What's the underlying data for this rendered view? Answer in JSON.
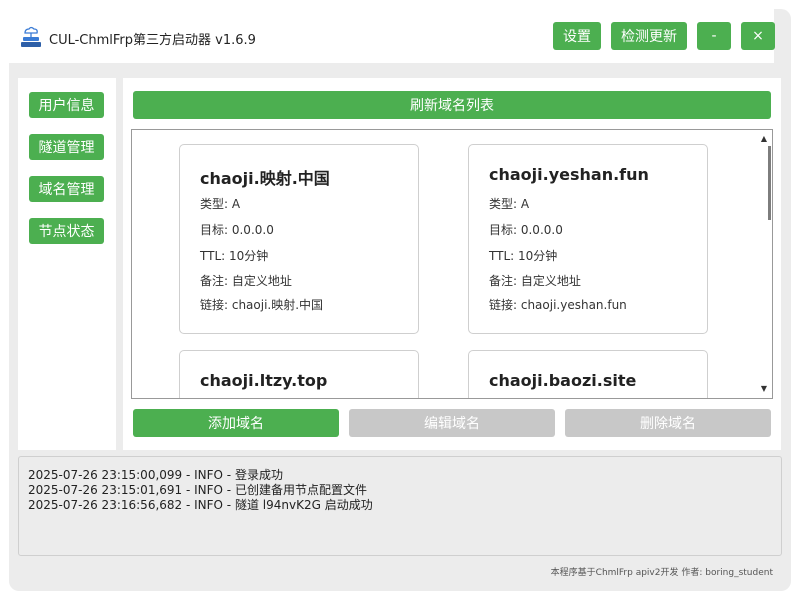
{
  "app": {
    "title": "CUL-ChmlFrp第三方启动器 v1.6.9",
    "icon": "cloud-server-icon"
  },
  "header": {
    "settings_label": "设置",
    "update_label": "检测更新",
    "minimize_label": "-",
    "close_label": "×"
  },
  "sidebar": {
    "items": [
      {
        "label": "用户信息"
      },
      {
        "label": "隧道管理"
      },
      {
        "label": "域名管理"
      },
      {
        "label": "节点状态"
      }
    ]
  },
  "main": {
    "refresh_label": "刷新域名列表",
    "domains": [
      {
        "name": "chaoji.映射.中国",
        "type": "类型: A",
        "target": "目标: 0.0.0.0",
        "ttl": "TTL: 10分钟",
        "remark": "备注: 自定义地址",
        "link": "链接: chaoji.映射.中国"
      },
      {
        "name": "chaoji.yeshan.fun",
        "type": "类型: A",
        "target": "目标: 0.0.0.0",
        "ttl": "TTL: 10分钟",
        "remark": "备注: 自定义地址",
        "link": "链接: chaoji.yeshan.fun"
      },
      {
        "name": "chaoji.ltzy.top"
      },
      {
        "name": "chaoji.baozi.site"
      }
    ],
    "add_label": "添加域名",
    "edit_label": "编辑域名",
    "delete_label": "删除域名"
  },
  "log": {
    "lines": [
      "2025-07-26 23:15:00,099 - INFO - 登录成功",
      "2025-07-26 23:15:01,691 - INFO - 已创建备用节点配置文件",
      "2025-07-26 23:16:56,682 - INFO - 隧道 l94nvK2G 启动成功"
    ]
  },
  "footer": {
    "text": "本程序基于ChmlFrp apiv2开发 作者: boring_student"
  },
  "colors": {
    "accent": "#4caf50",
    "disabled": "#c8c8c8",
    "panel": "#ececec"
  }
}
